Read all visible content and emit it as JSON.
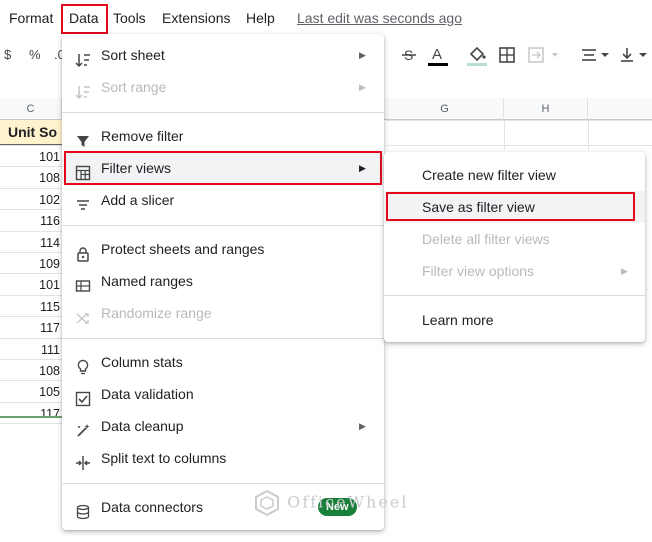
{
  "menubar": {
    "items": [
      "Format",
      "Data",
      "Tools",
      "Extensions",
      "Help"
    ],
    "last_edit": "Last edit was seconds ago"
  },
  "toolbar": {
    "currency": "$",
    "percent": "%",
    "decimal": ".0"
  },
  "columns": [
    "C",
    "G",
    "H"
  ],
  "sheet": {
    "header_cell": "Unit So",
    "values": [
      "101",
      "108",
      "102",
      "116",
      "114",
      "109",
      "101",
      "115",
      "117",
      "111",
      "108",
      "105",
      "117"
    ]
  },
  "data_menu": {
    "items": [
      {
        "label": "Sort sheet",
        "icon": "sort-icon",
        "submenu": true
      },
      {
        "label": "Sort range",
        "icon": "sort-icon",
        "submenu": true,
        "disabled": true
      },
      {
        "label": "Remove filter",
        "icon": "filter-icon"
      },
      {
        "label": "Filter views",
        "icon": "filter-views-icon",
        "submenu": true
      },
      {
        "label": "Add a slicer",
        "icon": "slicer-icon"
      },
      {
        "label": "Protect sheets and ranges",
        "icon": "lock-icon"
      },
      {
        "label": "Named ranges",
        "icon": "named-ranges-icon"
      },
      {
        "label": "Randomize range",
        "icon": "shuffle-icon",
        "disabled": true
      },
      {
        "label": "Column stats",
        "icon": "lightbulb-icon"
      },
      {
        "label": "Data validation",
        "icon": "validation-icon"
      },
      {
        "label": "Data cleanup",
        "icon": "wand-icon",
        "submenu": true
      },
      {
        "label": "Split text to columns",
        "icon": "split-icon"
      },
      {
        "label": "Data connectors",
        "icon": "database-icon",
        "badge": "New"
      }
    ]
  },
  "filter_views_menu": {
    "items": [
      {
        "label": "Create new filter view"
      },
      {
        "label": "Save as filter view"
      },
      {
        "label": "Delete all filter views",
        "disabled": true
      },
      {
        "label": "Filter view options",
        "disabled": true,
        "submenu": true
      },
      {
        "label": "Learn more"
      }
    ]
  },
  "watermark": "OfficeWheel",
  "colors": {
    "highlight": "#e0081a",
    "badge": "#188038",
    "text_color_underline": "#000000",
    "fill_color_underline": "#b7e1cd"
  }
}
